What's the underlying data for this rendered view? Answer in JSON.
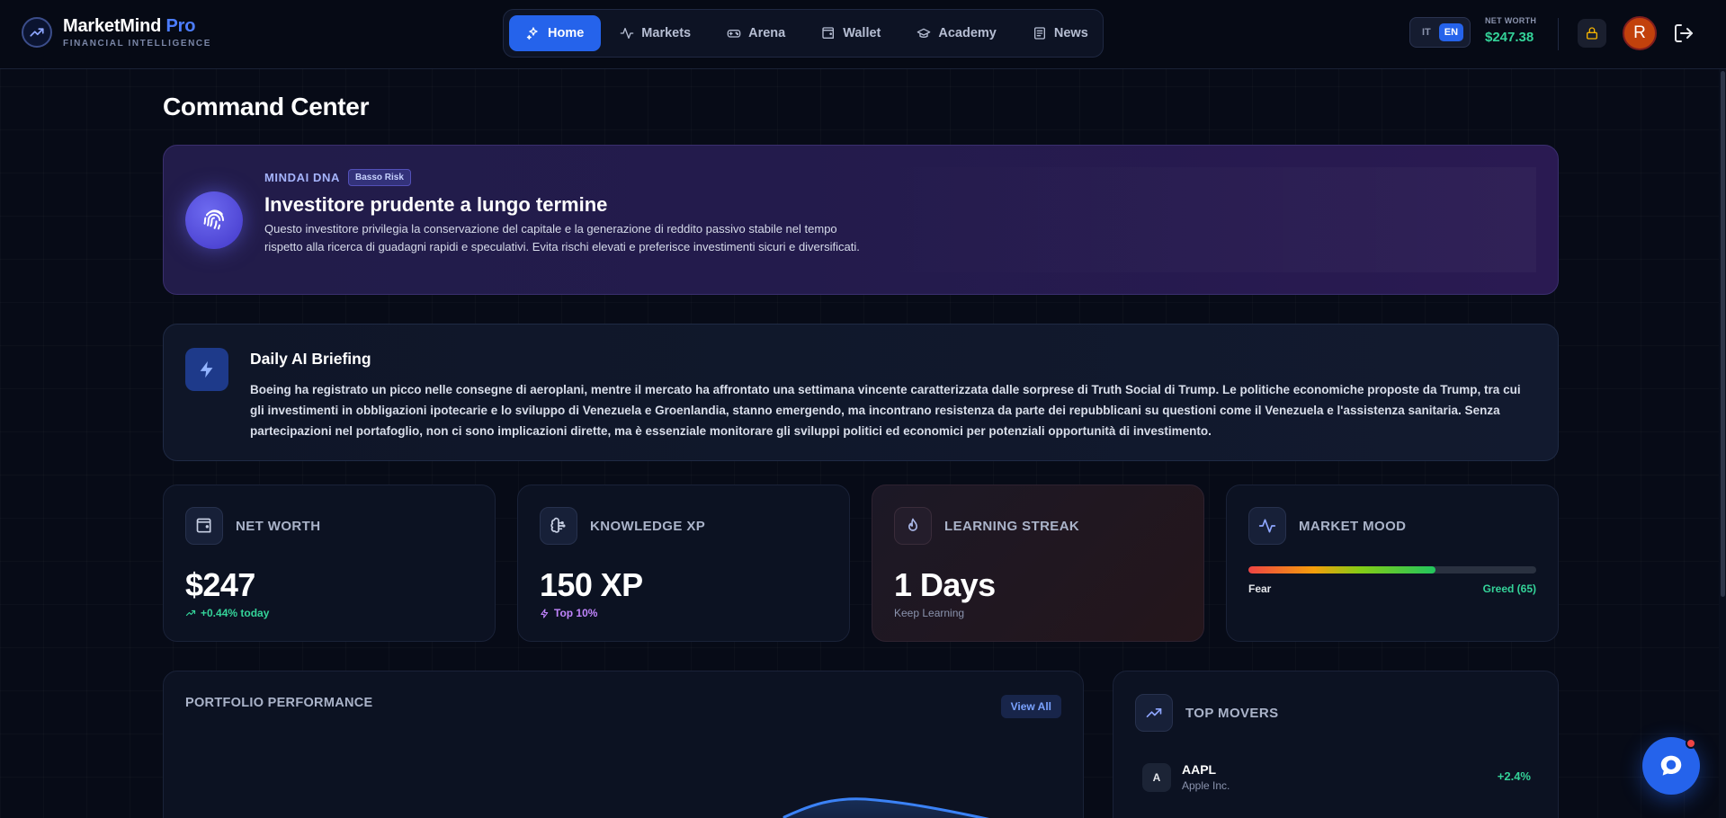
{
  "header": {
    "brand_name": "MarketMind",
    "brand_pro": "Pro",
    "brand_tagline": "FINANCIAL INTELLIGENCE",
    "nav": [
      {
        "label": "Home",
        "icon": "sparkles-icon",
        "active": true
      },
      {
        "label": "Markets",
        "icon": "activity-icon",
        "active": false
      },
      {
        "label": "Arena",
        "icon": "gamepad-icon",
        "active": false
      },
      {
        "label": "Wallet",
        "icon": "wallet-icon",
        "active": false
      },
      {
        "label": "Academy",
        "icon": "graduation-cap-icon",
        "active": false
      },
      {
        "label": "News",
        "icon": "newspaper-icon",
        "active": false
      }
    ],
    "lang_it": "IT",
    "lang_en": "EN",
    "lang_active": "EN",
    "net_worth_label": "NET WORTH",
    "net_worth_value": "$247.38",
    "avatar_initial": "R"
  },
  "page_title": "Command Center",
  "dna": {
    "kicker": "MINDAI DNA",
    "risk_badge": "Basso Risk",
    "title": "Investitore prudente a lungo termine",
    "description": "Questo investitore privilegia la conservazione del capitale e la generazione di reddito passivo stabile nel tempo rispetto alla ricerca di guadagni rapidi e speculativi. Evita rischi elevati e preferisce investimenti sicuri e diversificati."
  },
  "briefing": {
    "title": "Daily AI Briefing",
    "text": "Boeing ha registrato un picco nelle consegne di aeroplani, mentre il mercato ha affrontato una settimana vincente caratterizzata dalle sorprese di Truth Social di Trump. Le politiche economiche proposte da Trump, tra cui gli investimenti in obbligazioni ipotecarie e lo sviluppo di Venezuela e Groenlandia, stanno emergendo, ma incontrano resistenza da parte dei repubblicani su questioni come il Venezuela e l'assistenza sanitaria. Senza partecipazioni nel portafoglio, non ci sono implicazioni dirette, ma è essenziale monitorare gli sviluppi politici ed economici per potenziali opportunità di investimento."
  },
  "stats": {
    "net_worth": {
      "label": "NET WORTH",
      "value": "$247",
      "sub": "+0.44% today"
    },
    "knowledge": {
      "label": "KNOWLEDGE XP",
      "value": "150 XP",
      "sub": "Top 10%"
    },
    "streak": {
      "label": "LEARNING STREAK",
      "value": "1 Days",
      "sub": "Keep Learning"
    },
    "mood": {
      "label": "MARKET MOOD",
      "fear_label": "Fear",
      "greed_label": "Greed (65)",
      "level_percent": 65
    }
  },
  "portfolio": {
    "title": "PORTFOLIO PERFORMANCE",
    "view_all": "View All"
  },
  "movers": {
    "title": "TOP MOVERS",
    "items": [
      {
        "badge": "A",
        "symbol": "AAPL",
        "name": "Apple Inc.",
        "change": "+2.4%"
      }
    ]
  },
  "colors": {
    "accent": "#2563eb",
    "positive": "#34d399",
    "dna_purple": "#6366f1"
  }
}
